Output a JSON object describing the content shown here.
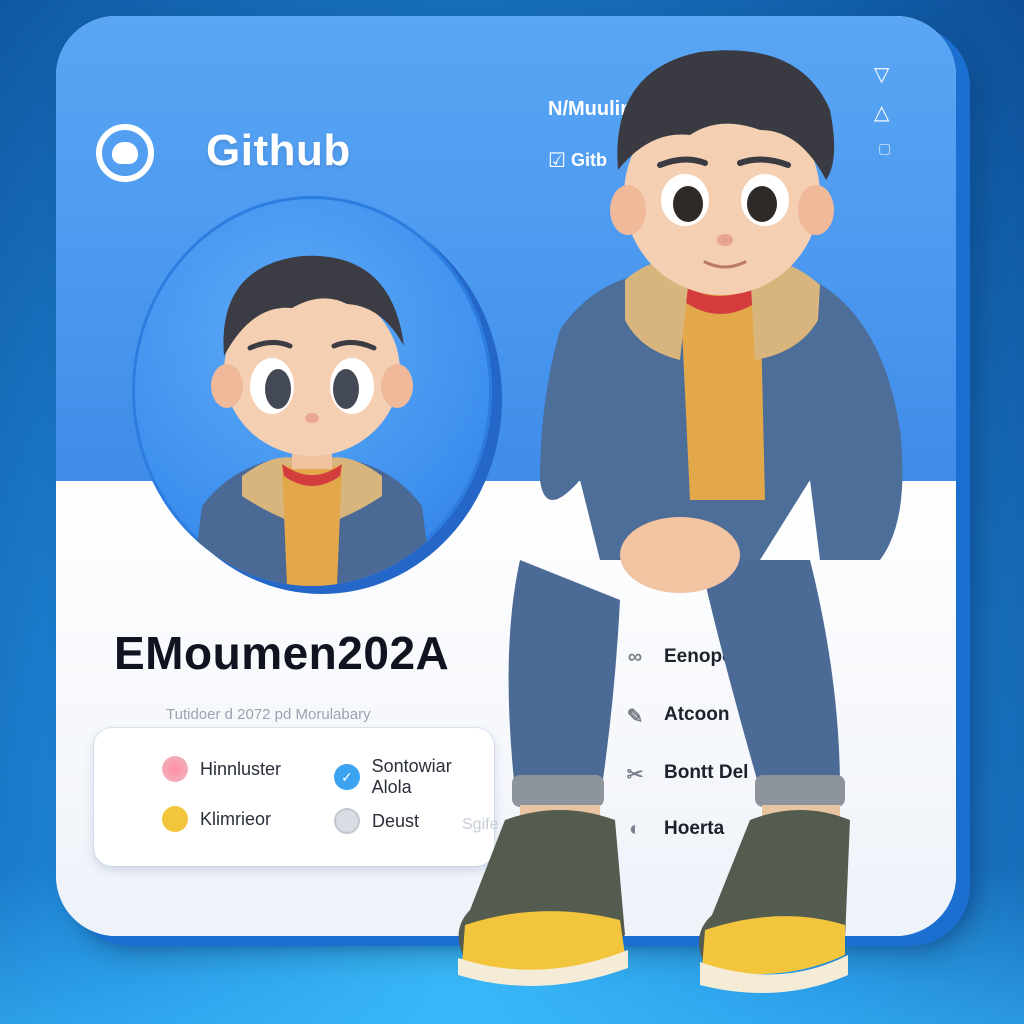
{
  "header": {
    "app_title": "Github",
    "top_right_line1": "N/Muulinn",
    "top_right_line2": "Gitb"
  },
  "profile": {
    "username": "EMoumen202A",
    "subtitle": "Tutidoer d 2072 pd Morulabary"
  },
  "info_box": {
    "items": [
      {
        "label": "Hinnluster",
        "icon": "pink-heart-icon"
      },
      {
        "label": "Sontowiar Alola",
        "icon": "bird-icon"
      },
      {
        "label": "Klimrieor",
        "icon": "sunglasses-icon"
      },
      {
        "label": "Deust",
        "icon": "globe-icon"
      },
      {
        "label": "Sgife",
        "icon": "faded-text"
      }
    ]
  },
  "right_list": {
    "items": [
      {
        "label": "Eenopeke",
        "icon": "link-icon"
      },
      {
        "label": "Atcoon",
        "icon": "pen-icon"
      },
      {
        "label": "Bontt Del",
        "icon": "scissors-icon"
      },
      {
        "label": "Hoerta",
        "icon": "badge-icon"
      }
    ]
  },
  "colors": {
    "card_blue": "#4a97ef",
    "accent_yellow": "#f2c53d",
    "accent_pink": "#ee6e86",
    "accent_blue": "#3ba3f0"
  }
}
